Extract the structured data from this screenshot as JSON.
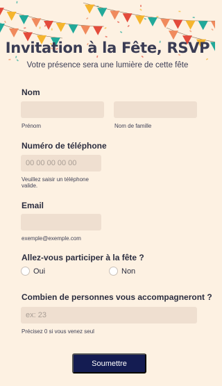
{
  "header": {
    "title": "Invitation à la Fête, RSVP",
    "subtitle": "Votre présence sera une lumière de cette fête"
  },
  "form": {
    "name": {
      "label": "Nom",
      "first_help": "Prénom",
      "last_help": "Nom de famille"
    },
    "phone": {
      "label": "Numéro de téléphone",
      "placeholder": "00 00 00 00 00",
      "help_line1": "Veuillez saisir un téléphone",
      "help_line2": "valide."
    },
    "email": {
      "label": "Email",
      "help": "exemple@exemple.com"
    },
    "attend": {
      "label": "Allez-vous participer à la fête ?",
      "options": [
        "Oui",
        "Non"
      ]
    },
    "guests": {
      "label": "Combien de personnes vous accompagneront ?",
      "placeholder": "ex: 23",
      "help": "Précisez 0 si vous venez seul"
    },
    "submit_label": "Soumettre"
  },
  "colors": {
    "background": "#fdf1e2",
    "field": "#efdfd0",
    "button": "#141c52",
    "flag_colors": [
      "#e34b3c",
      "#f5b52e",
      "#21a99a",
      "#f08a5d"
    ]
  },
  "icons": {
    "banner": "bunting-flags-icon"
  }
}
